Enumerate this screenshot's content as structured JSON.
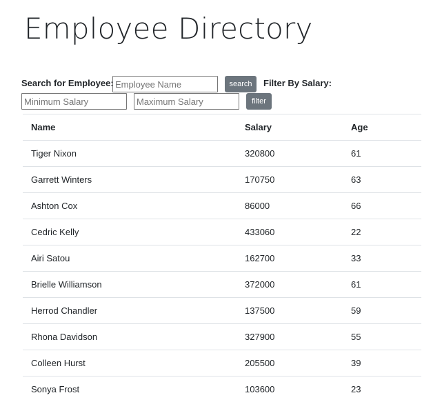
{
  "header": {
    "title": "Employee Directory"
  },
  "search": {
    "label": "Search for Employee:",
    "placeholder": "Employee Name",
    "value": "",
    "button_label": "search"
  },
  "filter": {
    "label": "Filter By Salary:",
    "min_placeholder": "Minimum Salary",
    "max_placeholder": "Maximum Salary",
    "button_label": "filter"
  },
  "table": {
    "columns": [
      "Name",
      "Salary",
      "Age"
    ],
    "rows": [
      {
        "name": "Tiger Nixon",
        "salary": "320800",
        "age": "61"
      },
      {
        "name": "Garrett Winters",
        "salary": "170750",
        "age": "63"
      },
      {
        "name": "Ashton Cox",
        "salary": "86000",
        "age": "66"
      },
      {
        "name": "Cedric Kelly",
        "salary": "433060",
        "age": "22"
      },
      {
        "name": "Airi Satou",
        "salary": "162700",
        "age": "33"
      },
      {
        "name": "Brielle Williamson",
        "salary": "372000",
        "age": "61"
      },
      {
        "name": "Herrod Chandler",
        "salary": "137500",
        "age": "59"
      },
      {
        "name": "Rhona Davidson",
        "salary": "327900",
        "age": "55"
      },
      {
        "name": "Colleen Hurst",
        "salary": "205500",
        "age": "39"
      },
      {
        "name": "Sonya Frost",
        "salary": "103600",
        "age": "23"
      }
    ]
  },
  "colors": {
    "button_bg": "#6c757d",
    "text": "#212529",
    "border": "#dee2e6"
  }
}
